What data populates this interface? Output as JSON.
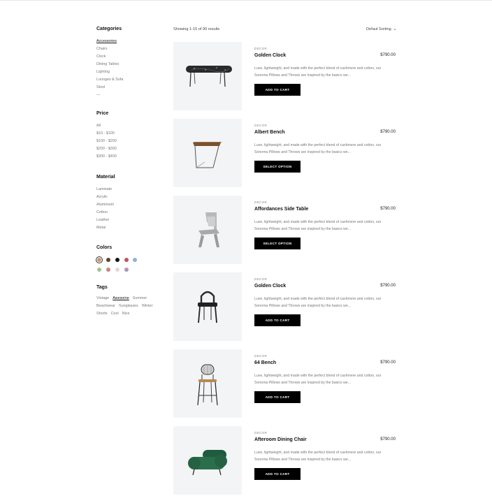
{
  "toolbar": {
    "result_count": "Showing 1-15 of 90 results",
    "sorting_label": "Defaut Sorting"
  },
  "sidebar": {
    "categories": {
      "title": "Categories",
      "items": [
        "Accessories",
        "Chairs",
        "Clock",
        "Dining Tables",
        "Lighting",
        "Lounges & Sofa",
        "Stool",
        "—"
      ]
    },
    "price": {
      "title": "Price",
      "items": [
        "All",
        "$10 - $100",
        "$100 - $200",
        "$200 - $300",
        "$300 - $400"
      ]
    },
    "material": {
      "title": "Material",
      "items": [
        "Laminate",
        "Acrylic",
        "Aluminium",
        "Cotton",
        "Leather",
        "Metal"
      ]
    },
    "colors": {
      "title": "Colors",
      "items": [
        "#c59a73",
        "#5b4337",
        "#141414",
        "#b5595a",
        "#8fb1d6",
        "#a5c08f",
        "#c98585",
        "#e3d7da",
        "#b094ba"
      ]
    },
    "tags": {
      "title": "Tags",
      "items": [
        "Vintage",
        "Awesome",
        "Summer",
        "Beachwear",
        "Sunglasses",
        "Winter",
        "Shorts",
        "Cool",
        "Nice"
      ]
    }
  },
  "products": [
    {
      "category": "DECOR",
      "name": "Golden Clock",
      "price": "$790.00",
      "description": "Luxe, lightweight, and made with the perfect blend of cashmere and cotton, our Sonoma Pillows and Throws are inspired by the basics we...",
      "button": "ADD TO CART",
      "image": "marble-bench-image"
    },
    {
      "category": "DECOR",
      "name": "Albert Bench",
      "price": "$790.00",
      "description": "Luxe, lightweight, and made with the perfect blend of cashmere and cotton, our Sonoma Pillows and Throws are inspired by the basics we...",
      "button": "SELECT OPTION",
      "image": "wood-side-table-image"
    },
    {
      "category": "DECOR",
      "name": "Affordances Side Table",
      "price": "$790.00",
      "description": "Luxe, lightweight, and made with the perfect blend of cashmere and cotton, our Sonoma Pillows and Throws are inspired by the basics we...",
      "button": "SELECT OPTION",
      "image": "grey-chair-image"
    },
    {
      "category": "DECOR",
      "name": "Golden Clock",
      "price": "$790.00",
      "description": "Luxe, lightweight, and made with the perfect blend of cashmere and cotton, our Sonoma Pillows and Throws are inspired by the basics we...",
      "button": "ADD TO CART",
      "image": "black-stool-image"
    },
    {
      "category": "DECOR",
      "name": "64 Bench",
      "price": "$790.00",
      "description": "Luxe, lightweight, and made with the perfect blend of cashmere and cotton, our Sonoma Pillows and Throws are inspired by the basics we...",
      "button": "ADD TO CART",
      "image": "bar-stool-image"
    },
    {
      "category": "DECOR",
      "name": "Afteroom Dining Chair",
      "price": "$790.00",
      "description": "Luxe, lightweight, and made with the perfect blend of cashmere and cotton, our Sonoma Pillows and Throws are inspired by the basics we...",
      "button": "ADD TO CART",
      "image": "green-sofa-image"
    }
  ]
}
